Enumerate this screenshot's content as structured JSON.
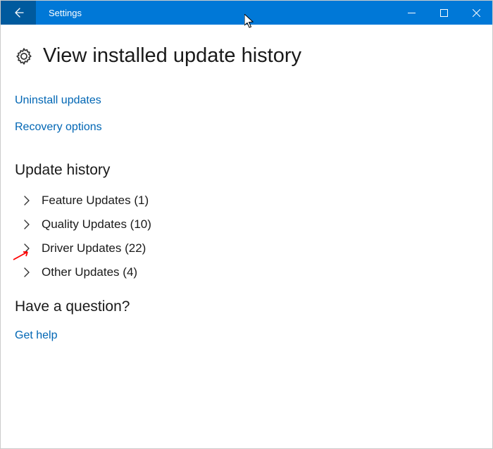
{
  "titlebar": {
    "title": "Settings"
  },
  "header": {
    "title": "View installed update history"
  },
  "links": {
    "uninstall": "Uninstall updates",
    "recovery": "Recovery options"
  },
  "sections": {
    "history_heading": "Update history",
    "categories": [
      {
        "label": "Feature Updates (1)"
      },
      {
        "label": "Quality Updates (10)"
      },
      {
        "label": "Driver Updates (22)"
      },
      {
        "label": "Other Updates (4)"
      }
    ],
    "question_heading": "Have a question?",
    "help_link": "Get help"
  }
}
